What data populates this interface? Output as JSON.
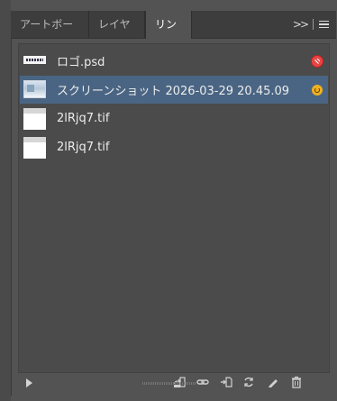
{
  "tabs": [
    {
      "label": "アートボード"
    },
    {
      "label": "レイヤー"
    },
    {
      "label": "リンク"
    }
  ],
  "panel": {
    "active_tab": "リンク",
    "collapse_icon": "double-chevron-right-icon",
    "menu_icon": "hamburger-menu-icon"
  },
  "links": [
    {
      "name": "ロゴ.psd",
      "thumbnail": "logo",
      "status": "missing",
      "status_color": "#e84545"
    },
    {
      "name": "スクリーンショット 2026-03-29 20.45.09",
      "thumbnail": "screenshot",
      "status": "modified",
      "status_color": "#f0b020",
      "selected": true
    },
    {
      "name": "2lRjq7.tif",
      "thumbnail": "tif",
      "status": ""
    },
    {
      "name": "2lRjq7.tif",
      "thumbnail": "tif",
      "status": ""
    }
  ],
  "toolbar": {
    "icons": [
      "play-icon",
      "relink-from-libraries-icon",
      "relink-icon",
      "go-to-link-icon",
      "update-link-icon",
      "edit-original-icon",
      "delete-icon"
    ]
  },
  "colors": {
    "panel_bg": "#535353",
    "tabbar_bg": "#3d3d3d",
    "selection": "#4a6583"
  }
}
